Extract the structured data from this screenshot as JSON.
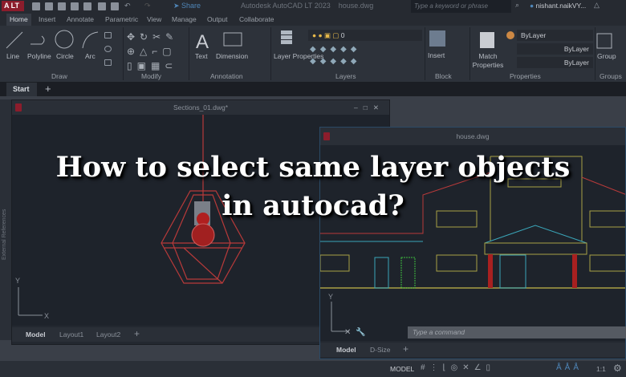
{
  "titlebar": {
    "logo": "A LT",
    "share": "Share",
    "app_title": "Autodesk AutoCAD LT 2023",
    "file": "house.dwg",
    "search_placeholder": "Type a keyword or phrase",
    "user": "nishant.naikVY..."
  },
  "ribbon_tabs": [
    "Home",
    "Insert",
    "Annotate",
    "Parametric",
    "View",
    "Manage",
    "Output",
    "Collaborate"
  ],
  "panels": {
    "draw": {
      "label": "Draw",
      "tools": [
        "Line",
        "Polyline",
        "Circle",
        "Arc"
      ]
    },
    "modify": {
      "label": "Modify"
    },
    "annotation": {
      "label": "Annotation",
      "tools": [
        "Text",
        "Dimension"
      ]
    },
    "layers": {
      "label": "Layers",
      "tool": "Layer Properties",
      "current_layer": "0"
    },
    "block": {
      "label": "Block",
      "tool": "Insert"
    },
    "properties": {
      "label": "Properties",
      "tool": "Match Properties",
      "color": "ByLayer",
      "linetype": "ByLayer",
      "lineweight": "ByLayer"
    },
    "groups": {
      "label": "Groups",
      "tool": "Group"
    }
  },
  "doc_tabs": {
    "start": "Start",
    "add": "+"
  },
  "sections_window": {
    "title": "Sections_01.dwg*",
    "side_label": "External References",
    "tabs": [
      "Model",
      "Layout1",
      "Layout2"
    ],
    "add": "+"
  },
  "house_window": {
    "title": "house.dwg",
    "tabs": [
      "Model",
      "D-Size"
    ],
    "add": "+",
    "command_placeholder": "Type a command"
  },
  "status": {
    "model": "MODEL",
    "scale": "1:1"
  },
  "headline": {
    "line1": "How to select same layer objects",
    "line2": "in autocad?"
  },
  "colors": {
    "accent": "#8c1d2c",
    "red_lines": "#c0393b",
    "cyan_lines": "#3aa6b9",
    "yellow_lines": "#a8a045",
    "green_lines": "#3fbf3f"
  }
}
